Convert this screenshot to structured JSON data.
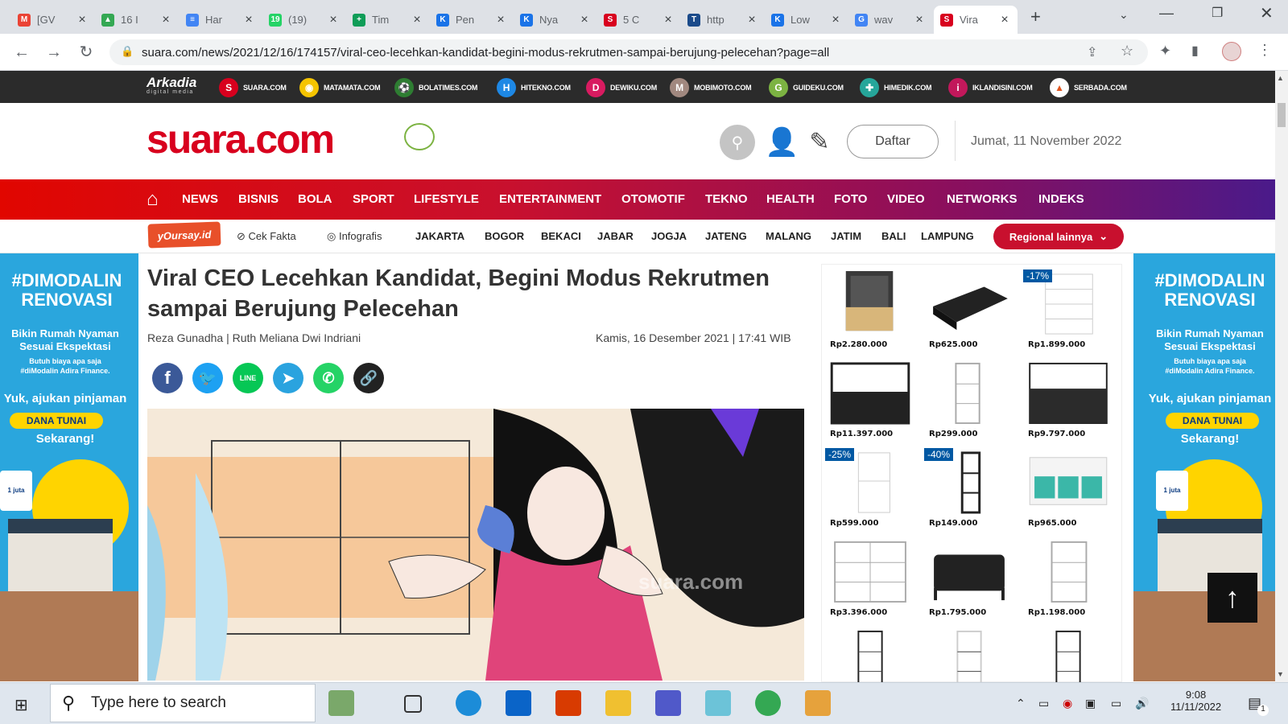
{
  "browser": {
    "tabs": [
      {
        "label": "[GV",
        "favicon": "gmail-icon",
        "color": "#ea4335",
        "glyph": "M"
      },
      {
        "label": "16 I",
        "favicon": "drive-icon",
        "color": "#34a853",
        "glyph": "▲"
      },
      {
        "label": "Har",
        "favicon": "docs-icon",
        "color": "#4285f4",
        "glyph": "≡"
      },
      {
        "label": "(19)",
        "favicon": "whatsapp-icon",
        "color": "#25d366",
        "glyph": "19"
      },
      {
        "label": "Tim",
        "favicon": "sheets-icon",
        "color": "#0f9d58",
        "glyph": "+"
      },
      {
        "label": "Pen",
        "favicon": "kompas-icon",
        "color": "#1a73e8",
        "glyph": "K"
      },
      {
        "label": "Nya",
        "favicon": "kompas-icon",
        "color": "#1a73e8",
        "glyph": "K"
      },
      {
        "label": "5 C",
        "favicon": "suara-icon",
        "color": "#d8001e",
        "glyph": "S"
      },
      {
        "label": "http",
        "favicon": "tempo-icon",
        "color": "#1a4a8a",
        "glyph": "T"
      },
      {
        "label": "Low",
        "favicon": "kompas-icon",
        "color": "#1a73e8",
        "glyph": "K"
      },
      {
        "label": "wav",
        "favicon": "google-icon",
        "color": "#4285f4",
        "glyph": "G"
      },
      {
        "label": "Vira",
        "favicon": "suara-icon",
        "color": "#d8001e",
        "glyph": "S"
      }
    ],
    "new_tab": "+",
    "url": "suara.com/news/2021/12/16/174157/viral-ceo-lecehkan-kandidat-begini-modus-rekrutmen-sampai-berujung-pelecehan?page=all"
  },
  "network": {
    "brand": "Arkadia",
    "brand_sub": "digital media",
    "sites": [
      {
        "label": "SUARA.COM",
        "color": "#d8001e",
        "glyph": "S"
      },
      {
        "label": "MATAMATA.COM",
        "color": "#f5c400",
        "glyph": "◉"
      },
      {
        "label": "BOLATIMES.COM",
        "color": "#2e7d32",
        "glyph": "⚽"
      },
      {
        "label": "HITEKNO.COM",
        "color": "#1e88e5",
        "glyph": "H"
      },
      {
        "label": "DEWIKU.COM",
        "color": "#d81b60",
        "glyph": "D"
      },
      {
        "label": "MOBIMOTO.COM",
        "color": "#a1887f",
        "glyph": "M"
      },
      {
        "label": "GUIDEKU.COM",
        "color": "#7cb342",
        "glyph": "G"
      },
      {
        "label": "HIMEDIK.COM",
        "color": "#26a69a",
        "glyph": "✚"
      },
      {
        "label": "IKLANDISINI.COM",
        "color": "#c2185b",
        "glyph": "i"
      },
      {
        "label": "SERBADA.COM",
        "color": "#ffffff",
        "glyph": "▲"
      }
    ]
  },
  "header": {
    "logo": "suara.com",
    "register_label": "Daftar",
    "date": "Jumat, 11 November 2022"
  },
  "menu": [
    "NEWS",
    "BISNIS",
    "BOLA",
    "SPORT",
    "LIFESTYLE",
    "ENTERTAINMENT",
    "OTOMOTIF",
    "TEKNO",
    "HEALTH",
    "FOTO",
    "VIDEO",
    "NETWORKS",
    "INDEKS"
  ],
  "submenu": {
    "yoursay": "yOursay.id",
    "cek_fakta": "Cek Fakta",
    "infografis": "Infografis",
    "regions": [
      "JAKARTA",
      "BOGOR",
      "BEKACI",
      "JABAR",
      "JOGJA",
      "JATENG",
      "MALANG",
      "JATIM",
      "BALI",
      "LAMPUNG"
    ],
    "more_regions": "Regional lainnya"
  },
  "article": {
    "title": "Viral CEO Lecehkan Kandidat, Begini Modus Rekrutmen sampai Berujung Pelecehan",
    "authors": "Reza Gunadha | Ruth Meliana Dwi Indriani",
    "date": "Kamis, 16 Desember 2021 | 17:41 WIB",
    "share": [
      "facebook",
      "twitter",
      "line",
      "telegram",
      "whatsapp",
      "copy-link"
    ],
    "image_watermark": "suara.com"
  },
  "side_ad": {
    "headline1": "#DIMODALIN",
    "headline2": "RENOVASI",
    "line1": "Bikin Rumah Nyaman",
    "line2": "Sesuai Ekspektasi",
    "line3": "Butuh biaya apa saja",
    "line4": "#diModalin Adira Finance.",
    "cta1": "Yuk, ajukan pinjaman",
    "badge": "DANA TUNAI",
    "cta2": "Sekarang!",
    "cashback": "1 juta"
  },
  "product_ad": {
    "items": [
      {
        "price": "Rp2.280.000",
        "discount": ""
      },
      {
        "price": "Rp625.000",
        "discount": ""
      },
      {
        "price": "Rp1.899.000",
        "discount": "-17%"
      },
      {
        "price": "Rp11.397.000",
        "discount": ""
      },
      {
        "price": "Rp299.000",
        "discount": ""
      },
      {
        "price": "Rp9.797.000",
        "discount": ""
      },
      {
        "price": "Rp599.000",
        "discount": "-25%"
      },
      {
        "price": "Rp149.000",
        "discount": "-40%"
      },
      {
        "price": "Rp965.000",
        "discount": ""
      },
      {
        "price": "Rp3.396.000",
        "discount": ""
      },
      {
        "price": "Rp1.795.000",
        "discount": ""
      },
      {
        "price": "Rp1.198.000",
        "discount": ""
      }
    ]
  },
  "taskbar": {
    "search_placeholder": "Type here to search",
    "time": "9:08",
    "date": "11/11/2022",
    "notification_count": "1"
  }
}
